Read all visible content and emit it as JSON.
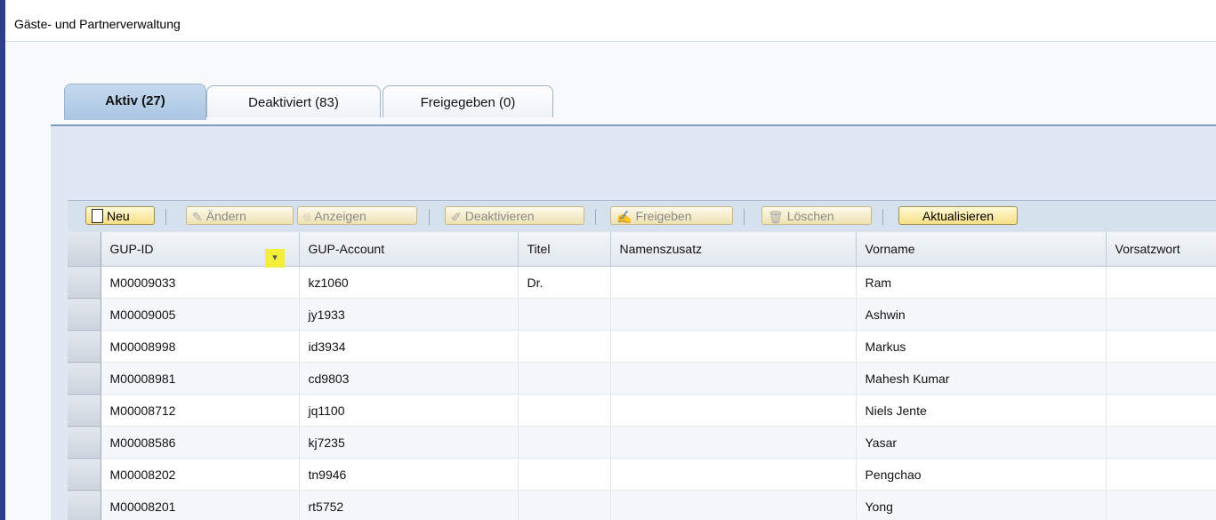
{
  "window": {
    "title": "Gäste- und Partnerverwaltung"
  },
  "tabs": [
    {
      "label": "Aktiv (27)",
      "active": true
    },
    {
      "label": "Deaktiviert (83)",
      "active": false
    },
    {
      "label": "Freigegeben (0)",
      "active": false
    }
  ],
  "toolbar": {
    "neu": "Neu",
    "aendern": "Ändern",
    "anzeigen": "Anzeigen",
    "deaktivieren": "Deaktivieren",
    "freigeben": "Freigeben",
    "loeschen": "Löschen",
    "aktualisieren": "Aktualisieren"
  },
  "table": {
    "columns": [
      "GUP-ID",
      "GUP-Account",
      "Titel",
      "Namenszusatz",
      "Vorname",
      "Vorsatzwort"
    ],
    "rows": [
      [
        "M00009033",
        "kz1060",
        "Dr.",
        "",
        "Ram",
        ""
      ],
      [
        "M00009005",
        "jy1933",
        "",
        "",
        "Ashwin",
        ""
      ],
      [
        "M00008998",
        "id3934",
        "",
        "",
        "Markus",
        ""
      ],
      [
        "M00008981",
        "cd9803",
        "",
        "",
        "Mahesh Kumar",
        ""
      ],
      [
        "M00008712",
        "jq1100",
        "",
        "",
        "Niels Jente",
        ""
      ],
      [
        "M00008586",
        "kj7235",
        "",
        "",
        "Yasar",
        ""
      ],
      [
        "M00008202",
        "tn9946",
        "",
        "",
        "Pengchao",
        ""
      ],
      [
        "M00008201",
        "rt5752",
        "",
        "",
        "Yong",
        ""
      ]
    ]
  }
}
